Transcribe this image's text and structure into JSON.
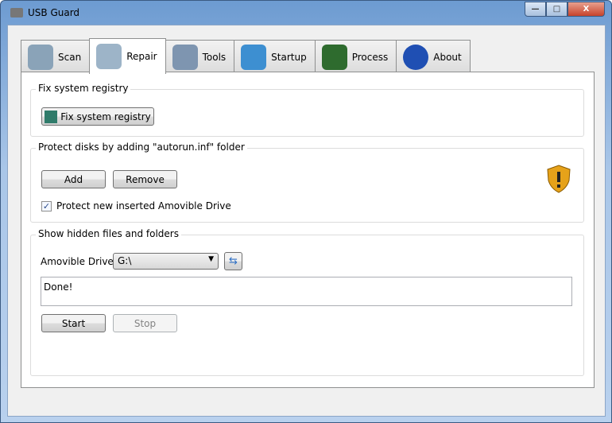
{
  "window": {
    "title": "USB Guard",
    "minimize": "—",
    "maximize": "□",
    "close": "X"
  },
  "tabs": [
    {
      "label": "Scan",
      "icon": "scan-drive-icon",
      "color": "#8aa3b8"
    },
    {
      "label": "Repair",
      "icon": "gear-checklist-icon",
      "color": "#9db4c8",
      "active": true
    },
    {
      "label": "Tools",
      "icon": "toolbox-icon",
      "color": "#7e95b0"
    },
    {
      "label": "Startup",
      "icon": "terminal-icon",
      "color": "#3d8fd1"
    },
    {
      "label": "Process",
      "icon": "monitor-graph-icon",
      "color": "#2e6b2e"
    },
    {
      "label": "About",
      "icon": "question-icon",
      "color": "#1f4fb3"
    }
  ],
  "registry": {
    "group": "Fix system registry",
    "button": "Fix system registry"
  },
  "protect": {
    "group": "Protect disks by adding \"autorun.inf\" folder",
    "add": "Add",
    "remove": "Remove",
    "checkbox": "Protect new inserted Amovible Drive",
    "checked": true,
    "shield_color": "#e6a21a"
  },
  "hidden": {
    "group": "Show hidden files and folders",
    "drive_label": "Amovible Drive:",
    "drive_value": "G:\\",
    "status": "Done!",
    "start": "Start",
    "stop": "Stop"
  }
}
